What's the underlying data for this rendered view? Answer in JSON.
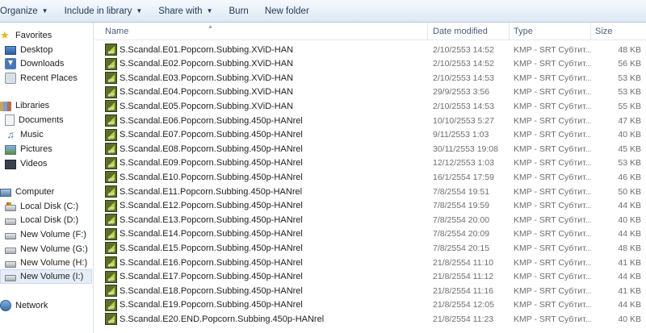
{
  "toolbar": {
    "organize": "Organize",
    "include_in_library": "Include in library",
    "share_with": "Share with",
    "burn": "Burn",
    "new_folder": "New folder"
  },
  "nav": {
    "favorites": "Favorites",
    "desktop": "Desktop",
    "downloads": "Downloads",
    "recent_places": "Recent Places",
    "libraries": "Libraries",
    "documents": "Documents",
    "music": "Music",
    "pictures": "Pictures",
    "videos": "Videos",
    "computer": "Computer",
    "drive_c": "Local Disk (C:)",
    "drive_d": "Local Disk (D:)",
    "drive_f": "New Volume (F:)",
    "drive_g": "New Volume (G:)",
    "drive_h": "New Volume (H:)",
    "drive_i": "New Volume (I:)",
    "network": "Network"
  },
  "columns": {
    "name": "Name",
    "date_modified": "Date modified",
    "type": "Type",
    "size": "Size"
  },
  "files": [
    {
      "name": "S.Scandal.E01.Popcorn.Subbing.XViD-HAN",
      "date": "2/10/2553 14:52",
      "type": "KMP - SRT Субтит...",
      "size": "48 KB"
    },
    {
      "name": "S.Scandal.E02.Popcorn.Subbing.XViD-HAN",
      "date": "2/10/2553 14:52",
      "type": "KMP - SRT Субтит...",
      "size": "56 KB"
    },
    {
      "name": "S.Scandal.E03.Popcorn.Subbing.XViD-HAN",
      "date": "2/10/2553 14:53",
      "type": "KMP - SRT Субтит...",
      "size": "53 KB"
    },
    {
      "name": "S.Scandal.E04.Popcorn.Subbing.XViD-HAN",
      "date": "29/9/2553 3:56",
      "type": "KMP - SRT Субтит...",
      "size": "53 KB"
    },
    {
      "name": "S.Scandal.E05.Popcorn.Subbing.XViD-HAN",
      "date": "2/10/2553 14:53",
      "type": "KMP - SRT Субтит...",
      "size": "55 KB"
    },
    {
      "name": "S.Scandal.E06.Popcorn.Subbing.450p-HANrel",
      "date": "10/10/2553 5:27",
      "type": "KMP - SRT Субтит...",
      "size": "47 KB"
    },
    {
      "name": "S.Scandal.E07.Popcorn.Subbing.450p-HANrel",
      "date": "9/11/2553 1:03",
      "type": "KMP - SRT Субтит...",
      "size": "40 KB"
    },
    {
      "name": "S.Scandal.E08.Popcorn.Subbing.450p-HANrel",
      "date": "30/11/2553 19:08",
      "type": "KMP - SRT Субтит...",
      "size": "45 KB"
    },
    {
      "name": "S.Scandal.E09.Popcorn.Subbing.450p-HANrel",
      "date": "12/12/2553 1:03",
      "type": "KMP - SRT Субтит...",
      "size": "53 KB"
    },
    {
      "name": "S.Scandal.E10.Popcorn.Subbing.450p-HANrel",
      "date": "16/1/2554 17:59",
      "type": "KMP - SRT Субтит...",
      "size": "46 KB"
    },
    {
      "name": "S.Scandal.E11.Popcorn.Subbing.450p-HANrel",
      "date": "7/8/2554 19:51",
      "type": "KMP - SRT Субтит...",
      "size": "50 KB"
    },
    {
      "name": "S.Scandal.E12.Popcorn.Subbing.450p-HANrel",
      "date": "7/8/2554 19:59",
      "type": "KMP - SRT Субтит...",
      "size": "44 KB"
    },
    {
      "name": "S.Scandal.E13.Popcorn.Subbing.450p-HANrel",
      "date": "7/8/2554 20:00",
      "type": "KMP - SRT Субтит...",
      "size": "40 KB"
    },
    {
      "name": "S.Scandal.E14.Popcorn.Subbing.450p-HANrel",
      "date": "7/8/2554 20:09",
      "type": "KMP - SRT Субтит...",
      "size": "44 KB"
    },
    {
      "name": "S.Scandal.E15.Popcorn.Subbing.450p-HANrel",
      "date": "7/8/2554 20:15",
      "type": "KMP - SRT Субтит...",
      "size": "48 KB"
    },
    {
      "name": "S.Scandal.E16.Popcorn.Subbing.450p-HANrel",
      "date": "21/8/2554 11:10",
      "type": "KMP - SRT Субтит...",
      "size": "41 KB"
    },
    {
      "name": "S.Scandal.E17.Popcorn.Subbing.450p-HANrel",
      "date": "21/8/2554 11:12",
      "type": "KMP - SRT Субтит...",
      "size": "44 KB"
    },
    {
      "name": "S.Scandal.E18.Popcorn.Subbing.450p-HANrel",
      "date": "21/8/2554 11:16",
      "type": "KMP - SRT Субтит...",
      "size": "41 KB"
    },
    {
      "name": "S.Scandal.E19.Popcorn.Subbing.450p-HANrel",
      "date": "21/8/2554 12:05",
      "type": "KMP - SRT Субтит...",
      "size": "44 KB"
    },
    {
      "name": "S.Scandal.E20.END.Popcorn.Subbing.450p-HANrel",
      "date": "21/8/2554 11:23",
      "type": "KMP - SRT Субтит...",
      "size": "40 KB"
    }
  ]
}
